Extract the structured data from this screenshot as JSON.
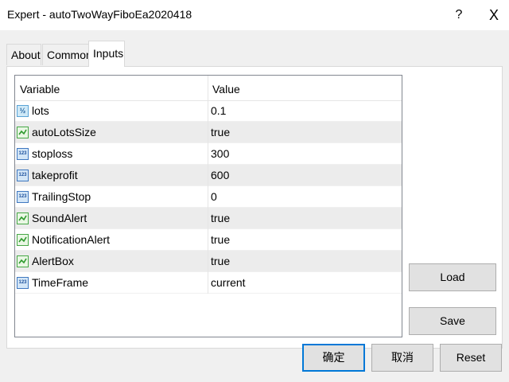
{
  "window": {
    "title": "Expert - autoTwoWayFiboEa2020418",
    "help_label": "?",
    "close_label": "X"
  },
  "tabs": [
    {
      "label": "About"
    },
    {
      "label": "Common"
    },
    {
      "label": "Inputs",
      "active": true
    }
  ],
  "table": {
    "columns": [
      "Variable",
      "Value"
    ],
    "rows": [
      {
        "name": "lots",
        "value": "0.1",
        "icon": "fraction-icon"
      },
      {
        "name": "autoLotsSize",
        "value": "true",
        "icon": "boolean-icon"
      },
      {
        "name": "stoploss",
        "value": "300",
        "icon": "integer-icon"
      },
      {
        "name": "takeprofit",
        "value": "600",
        "icon": "integer-icon"
      },
      {
        "name": "TrailingStop",
        "value": "0",
        "icon": "integer-icon"
      },
      {
        "name": "SoundAlert",
        "value": "true",
        "icon": "boolean-icon"
      },
      {
        "name": "NotificationAlert",
        "value": "true",
        "icon": "boolean-icon"
      },
      {
        "name": "AlertBox",
        "value": "true",
        "icon": "boolean-icon"
      },
      {
        "name": "TimeFrame",
        "value": "current",
        "icon": "integer-icon"
      }
    ]
  },
  "icon_text": {
    "fraction": "½",
    "integer": "123"
  },
  "buttons": {
    "load": "Load",
    "save": "Save",
    "ok": "确定",
    "cancel": "取消",
    "reset": "Reset"
  },
  "colors": {
    "focus_border": "#0078d7",
    "alt_row": "#ececec",
    "dialog_bg": "#f0f0f0"
  }
}
